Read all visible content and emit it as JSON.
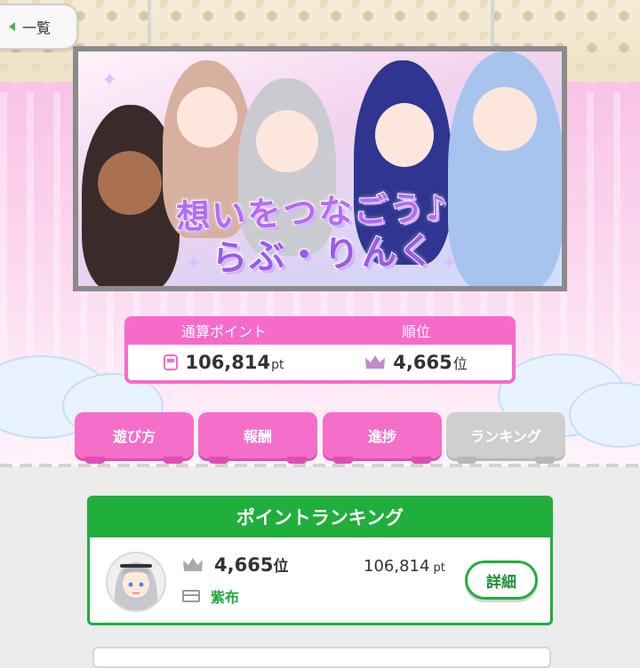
{
  "nav": {
    "back_label": "一覧"
  },
  "banner": {
    "title_line1": "想いをつなごう♪",
    "title_line2": "らぶ・りんく"
  },
  "summary": {
    "points_header": "通算ポイント",
    "rank_header": "順位",
    "points_value": "106,814",
    "points_unit": "pt",
    "rank_value": "4,665",
    "rank_unit": "位"
  },
  "tabs": [
    {
      "label": "遊び方",
      "state": "enabled"
    },
    {
      "label": "報酬",
      "state": "enabled"
    },
    {
      "label": "進捗",
      "state": "enabled"
    },
    {
      "label": "ランキング",
      "state": "selected"
    }
  ],
  "ranking_card": {
    "title": "ポイントランキング",
    "rank_value": "4,665",
    "rank_unit": "位",
    "points_value": "106,814",
    "points_unit": "pt",
    "player_name": "紫布",
    "detail_label": "詳細"
  },
  "colors": {
    "pink": "#f66bc9",
    "green": "#20ae3c",
    "tab_disabled": "#cfcfcf",
    "crown": "#c58ac9"
  },
  "icons": [
    "back-arrow-icon",
    "train-icon",
    "crown-icon",
    "card-icon",
    "sparkle-icon"
  ]
}
